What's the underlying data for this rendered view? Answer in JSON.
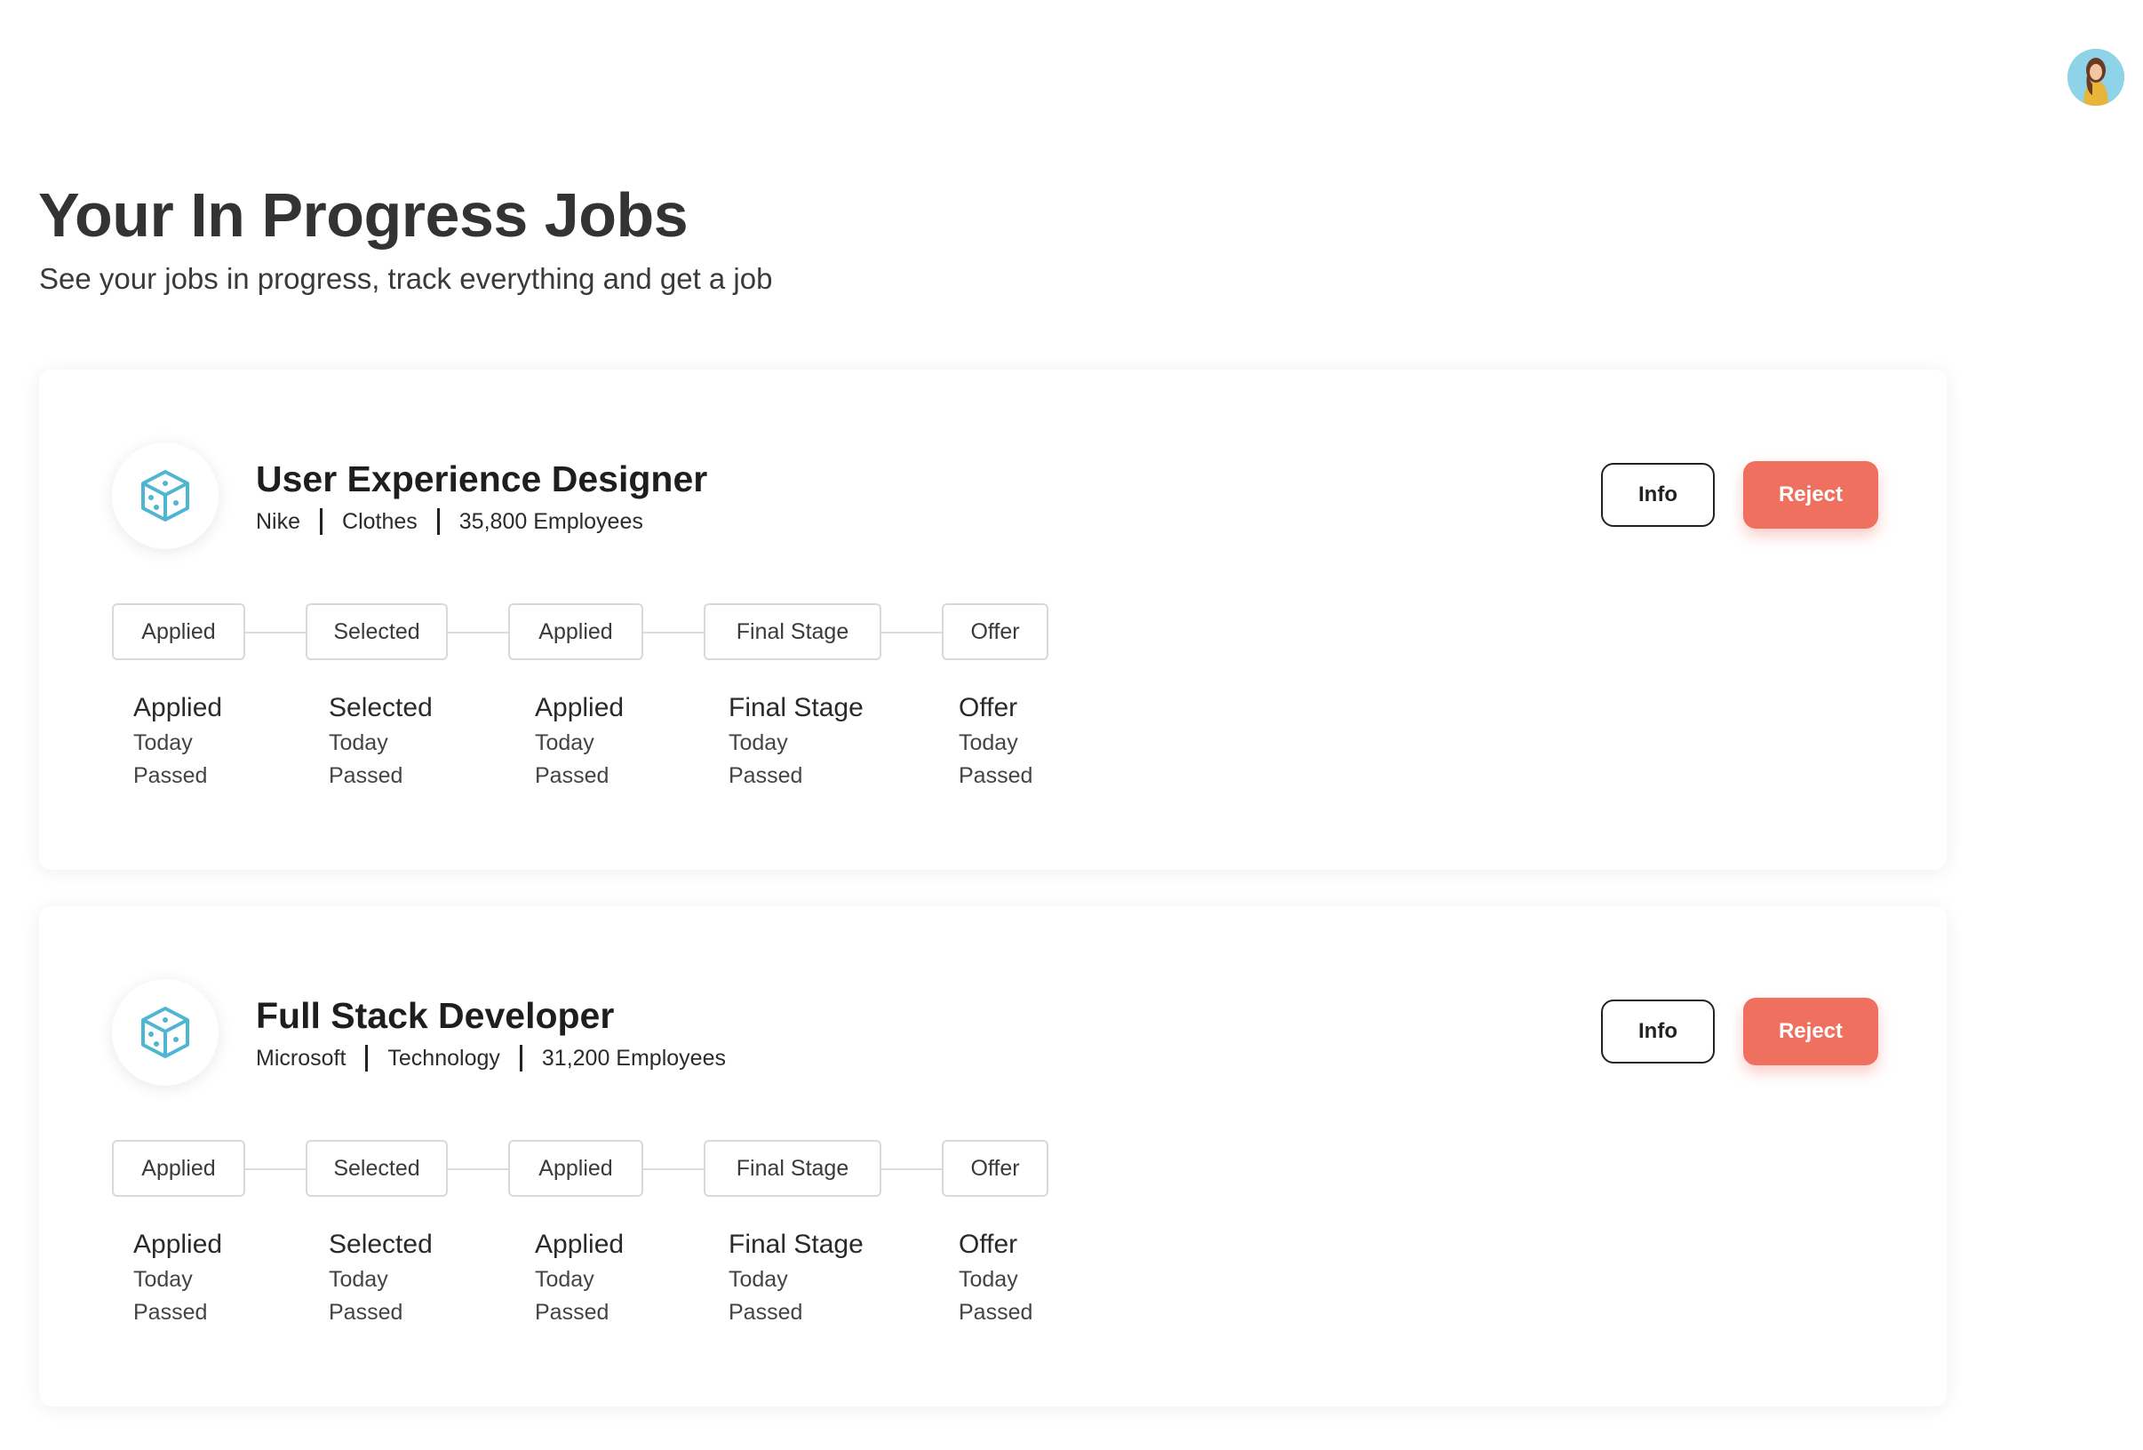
{
  "header": {
    "title": "Your In Progress Jobs",
    "subtitle": "See your jobs in progress, track everything and get a job"
  },
  "user": {
    "avatar_icon": "user-avatar"
  },
  "jobs": [
    {
      "title": "User Experience Designer",
      "company": "Nike",
      "industry": "Clothes",
      "employees": "35,800 Employees",
      "logo_icon": "cube-icon",
      "info_label": "Info",
      "reject_label": "Reject",
      "stages": [
        {
          "pill": "Applied",
          "name": "Applied",
          "date": "Today",
          "status": "Passed"
        },
        {
          "pill": "Selected",
          "name": "Selected",
          "date": "Today",
          "status": "Passed"
        },
        {
          "pill": "Applied",
          "name": "Applied",
          "date": "Today",
          "status": "Passed"
        },
        {
          "pill": "Final Stage",
          "name": "Final Stage",
          "date": "Today",
          "status": "Passed"
        },
        {
          "pill": "Offer",
          "name": "Offer",
          "date": "Today",
          "status": "Passed"
        }
      ]
    },
    {
      "title": "Full Stack Developer",
      "company": "Microsoft",
      "industry": "Technology",
      "employees": "31,200 Employees",
      "logo_icon": "cube-icon",
      "info_label": "Info",
      "reject_label": "Reject",
      "stages": [
        {
          "pill": "Applied",
          "name": "Applied",
          "date": "Today",
          "status": "Passed"
        },
        {
          "pill": "Selected",
          "name": "Selected",
          "date": "Today",
          "status": "Passed"
        },
        {
          "pill": "Applied",
          "name": "Applied",
          "date": "Today",
          "status": "Passed"
        },
        {
          "pill": "Final Stage",
          "name": "Final Stage",
          "date": "Today",
          "status": "Passed"
        },
        {
          "pill": "Offer",
          "name": "Offer",
          "date": "Today",
          "status": "Passed"
        }
      ]
    }
  ],
  "colors": {
    "accent_reject": "#f07060",
    "logo_icon": "#4fb6d2",
    "stage_border": "#d9d9d9"
  }
}
